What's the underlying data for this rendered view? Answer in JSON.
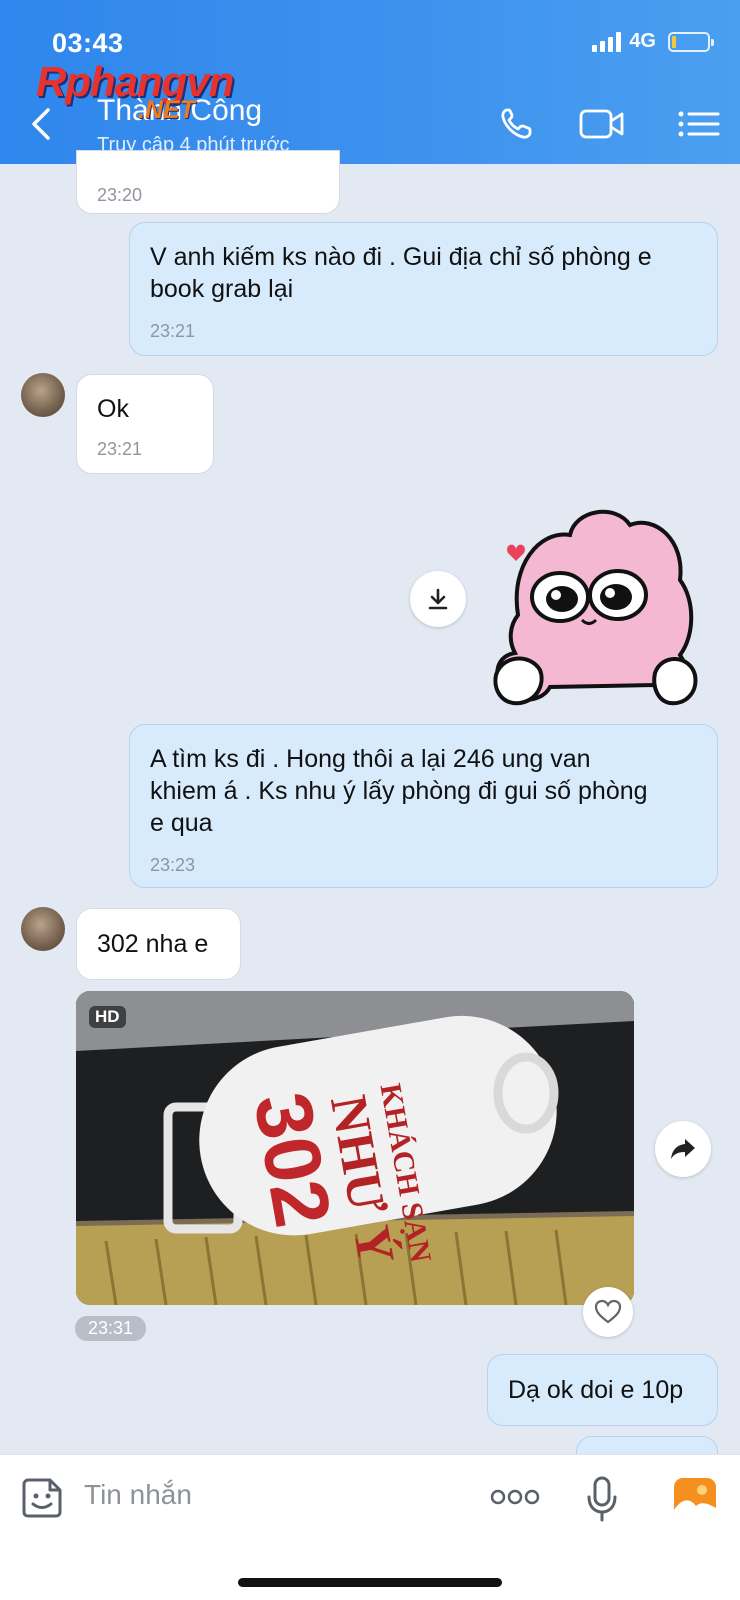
{
  "status": {
    "time": "03:43",
    "network": "4G"
  },
  "watermark": {
    "brand": "Rphangvn",
    "suffix": ".NET"
  },
  "header": {
    "name": "Thành Công",
    "last_seen": "Truy cập 4 phút trước"
  },
  "messages": [
    {
      "id": "m0",
      "dir": "in",
      "text": "",
      "time": "23:20"
    },
    {
      "id": "m1",
      "dir": "out",
      "lines": [
        "V anh kiếm ks nào đi . Gui địa chỉ số phòng e",
        "book grab lại"
      ],
      "time": "23:21"
    },
    {
      "id": "m2",
      "dir": "in",
      "text": "Ok",
      "time": "23:21"
    },
    {
      "id": "m3",
      "dir": "out",
      "type": "sticker"
    },
    {
      "id": "m4",
      "dir": "out",
      "lines": [
        "A tìm ks đi . Hong thôi a lại 246 ung van",
        "khiem á . Ks nhu ý lấy phòng đi gui số phòng",
        "e qua"
      ],
      "time": "23:23"
    },
    {
      "id": "m5",
      "dir": "in",
      "text": "302 nha e"
    },
    {
      "id": "m6",
      "dir": "in",
      "type": "photo",
      "badge": "HD",
      "time": "23:31",
      "photo_text": {
        "line1": "KHÁCH SẠN",
        "line2": "NHƯ Ý",
        "number": "302"
      }
    },
    {
      "id": "m7",
      "dir": "out",
      "text": "Dạ ok doi e 10p"
    }
  ],
  "input": {
    "placeholder": "Tin nhắn"
  }
}
